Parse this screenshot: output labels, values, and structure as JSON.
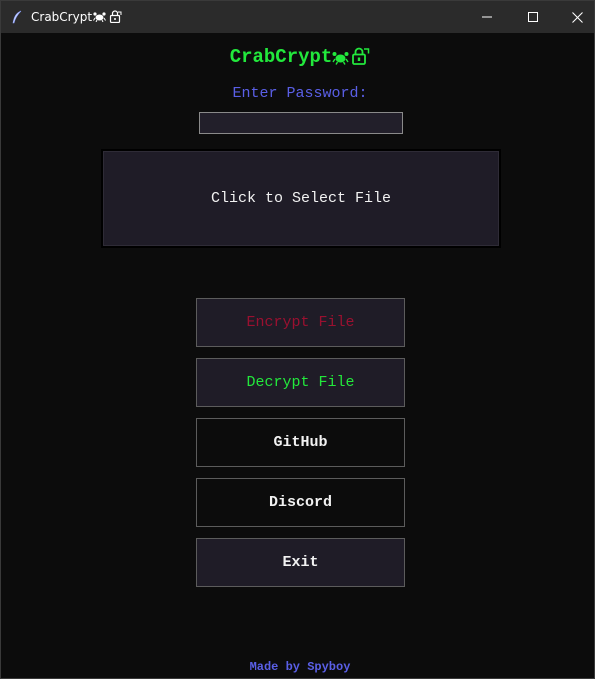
{
  "window": {
    "title": "CrabCrypt",
    "title_icons": [
      "crab-icon",
      "lock-icon"
    ],
    "controls": [
      "minimize",
      "maximize",
      "close"
    ]
  },
  "app": {
    "heading": "CrabCrypt",
    "heading_icons": [
      "crab-icon",
      "lock-icon"
    ],
    "password_label": "Enter Password:",
    "password_value": "",
    "file_select_label": "Click to Select File",
    "buttons": {
      "encrypt": "Encrypt File",
      "decrypt": "Decrypt File",
      "github": "GitHub",
      "discord": "Discord",
      "exit": "Exit"
    },
    "footer": "Made by Spyboy"
  },
  "colors": {
    "background": "#0c0c0c",
    "titlebar": "#2b2b2b",
    "heading_green": "#22e83c",
    "label_blue": "#5a5fe6",
    "encrypt_red": "#9a1030",
    "decrypt_green": "#22e83c",
    "button_text_white": "#f2f2f2",
    "panel": "#1f1c27"
  }
}
